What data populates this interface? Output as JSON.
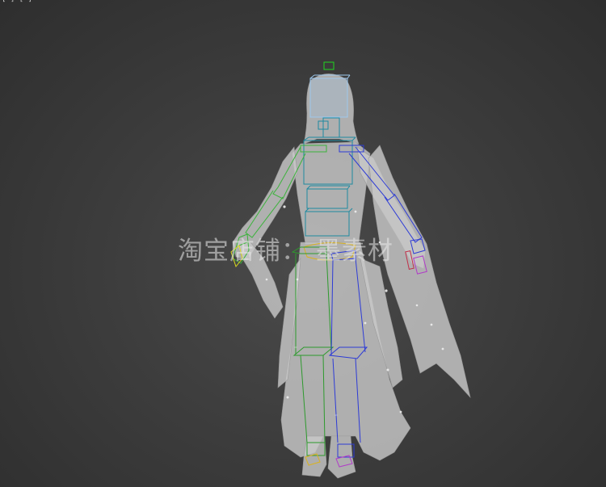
{
  "viewport": {
    "label": "[ ] [ ]",
    "background": "#3d3d3d"
  },
  "watermark": {
    "text": "淘宝店铺：      墨素材"
  },
  "model": {
    "mesh_color": "#c9c9c9",
    "bone_colors": {
      "head": "#9ec9ee",
      "spine": "#1e8aa0",
      "left_arm": "#3bb33b",
      "right_arm": "#2d3bd6",
      "left_leg": "#2d9a2d",
      "right_leg": "#2d3bd6",
      "pelvis": "#d9b21e",
      "hand_right": "#c0304a",
      "hand_right_2": "#b03ac8",
      "head_top": "#1fd61f"
    }
  }
}
